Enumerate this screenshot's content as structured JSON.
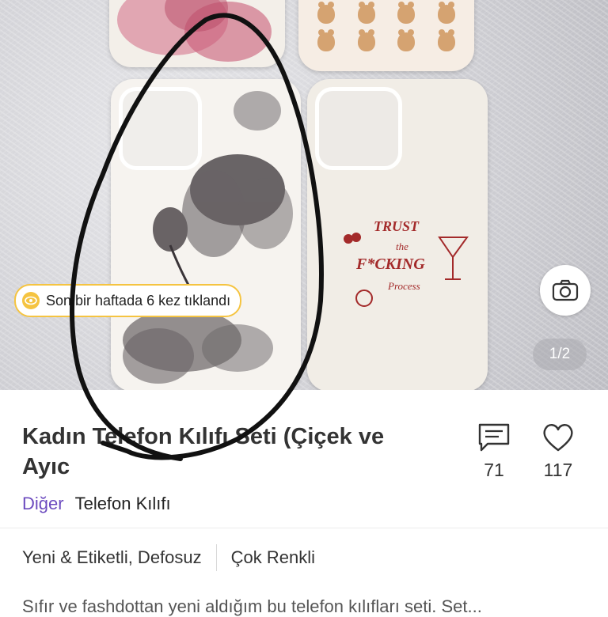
{
  "badge": {
    "text": "Son bir haftada 6 kez tıklandı",
    "icon": "eye-icon"
  },
  "photo": {
    "pager": "1/2",
    "case_quote": {
      "line1": "TRUST",
      "line2": "the",
      "line3": "F*CKING",
      "line4": "Process"
    }
  },
  "product": {
    "title": "Kadın Telefon Kılıfı Seti (Çiçek ve Ayıc",
    "comments": "71",
    "likes": "117",
    "category_main": "Diğer",
    "category_sub": "Telefon Kılıfı",
    "condition": "Yeni & Etiketli, Defosuz",
    "color": "Çok Renkli",
    "description": "Sıfır ve fashdottan yeni aldığım bu telefon kılıfları seti. Set..."
  },
  "colors": {
    "accent": "#6c4bbf",
    "badge_border": "#f5c441",
    "quote_red": "#a32a2a"
  }
}
